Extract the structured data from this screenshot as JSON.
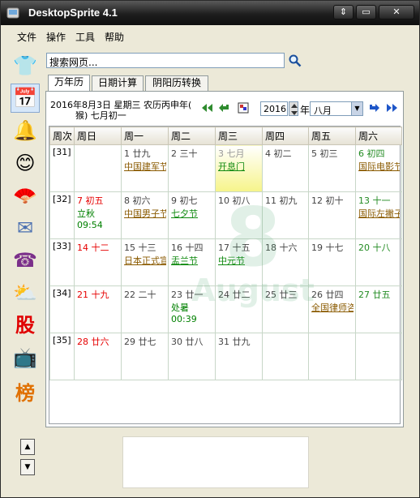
{
  "window": {
    "title": "DesktopSprite 4.1",
    "controls": [
      "⇕",
      "▭",
      "✕"
    ]
  },
  "menu": [
    "文件",
    "操作",
    "工具",
    "帮助"
  ],
  "sidebar": {
    "items": [
      {
        "name": "shirt-icon",
        "glyph": "👕"
      },
      {
        "name": "calendar-icon",
        "glyph": "📅"
      },
      {
        "name": "bell-icon",
        "glyph": "🔔"
      },
      {
        "name": "face-icon",
        "glyph": "😊"
      },
      {
        "name": "fan-icon",
        "glyph": "🪭"
      },
      {
        "name": "mail-icon",
        "glyph": "✉"
      },
      {
        "name": "phone-icon",
        "glyph": "☎"
      },
      {
        "name": "weather-icon",
        "glyph": "⛅"
      },
      {
        "name": "stock-icon",
        "glyph": "股"
      },
      {
        "name": "tv-icon",
        "glyph": "📺"
      },
      {
        "name": "rank-icon",
        "glyph": "榜"
      }
    ],
    "up": "▲",
    "down": "▼"
  },
  "search": {
    "placeholder": "搜索网页..."
  },
  "tabs": [
    "万年历",
    "日期计算",
    "阴阳历转换"
  ],
  "calendar": {
    "info_line1": "2016年8月3日 星期三 农历丙申年(",
    "info_line2": "猴) 七月初一",
    "year": "2016",
    "year_unit": "年",
    "month": "八月",
    "headers": [
      "周次",
      "周日",
      "周一",
      "周二",
      "周三",
      "周四",
      "周五",
      "周六"
    ],
    "weeks": [
      {
        "wk": "[31]",
        "days": [
          null,
          {
            "num": "1",
            "lunar": "廿九",
            "fest": "中国建军节",
            "ftype": "brown"
          },
          {
            "num": "2",
            "lunar": "三十"
          },
          {
            "num": "3",
            "lunar": "七月",
            "fest": "开息门",
            "ftype": "green",
            "today": true
          },
          {
            "num": "4",
            "lunar": "初二"
          },
          {
            "num": "5",
            "lunar": "初三"
          },
          {
            "num": "6",
            "lunar": "初四",
            "fest": "国际电影节",
            "ftype": "brown"
          }
        ]
      },
      {
        "wk": "[32]",
        "days": [
          {
            "num": "7",
            "lunar": "初五",
            "term": "立秋",
            "time": "09:54"
          },
          {
            "num": "8",
            "lunar": "初六",
            "fest": "中国男子节",
            "ftype": "brown"
          },
          {
            "num": "9",
            "lunar": "初七",
            "fest": "七夕节",
            "ftype": "green"
          },
          {
            "num": "10",
            "lunar": "初八"
          },
          {
            "num": "11",
            "lunar": "初九"
          },
          {
            "num": "12",
            "lunar": "初十"
          },
          {
            "num": "13",
            "lunar": "十一",
            "fest": "国际左撇子",
            "ftype": "brown"
          }
        ]
      },
      {
        "wk": "[33]",
        "days": [
          {
            "num": "14",
            "lunar": "十二"
          },
          {
            "num": "15",
            "lunar": "十三",
            "fest": "日本正式宣",
            "ftype": "brown"
          },
          {
            "num": "16",
            "lunar": "十四",
            "fest": "盂兰节",
            "ftype": "green"
          },
          {
            "num": "17",
            "lunar": "十五",
            "fest": "中元节",
            "ftype": "green"
          },
          {
            "num": "18",
            "lunar": "十六"
          },
          {
            "num": "19",
            "lunar": "十七"
          },
          {
            "num": "20",
            "lunar": "十八"
          }
        ]
      },
      {
        "wk": "[34]",
        "days": [
          {
            "num": "21",
            "lunar": "十九"
          },
          {
            "num": "22",
            "lunar": "二十"
          },
          {
            "num": "23",
            "lunar": "廿一",
            "term": "处暑",
            "time": "00:39"
          },
          {
            "num": "24",
            "lunar": "廿二"
          },
          {
            "num": "25",
            "lunar": "廿三"
          },
          {
            "num": "26",
            "lunar": "廿四",
            "fest": "全国律师咨",
            "ftype": "brown"
          },
          {
            "num": "27",
            "lunar": "廿五"
          }
        ]
      },
      {
        "wk": "[35]",
        "days": [
          {
            "num": "28",
            "lunar": "廿六"
          },
          {
            "num": "29",
            "lunar": "廿七"
          },
          {
            "num": "30",
            "lunar": "廿八"
          },
          {
            "num": "31",
            "lunar": "廿九"
          },
          null,
          null,
          null
        ]
      }
    ],
    "watermark_big": "8",
    "watermark_word": "August"
  },
  "colors": {
    "sunday": "#e60000",
    "saturday": "#228b22",
    "festival": "#8a5a00",
    "today_bg": "#f6f48a"
  }
}
